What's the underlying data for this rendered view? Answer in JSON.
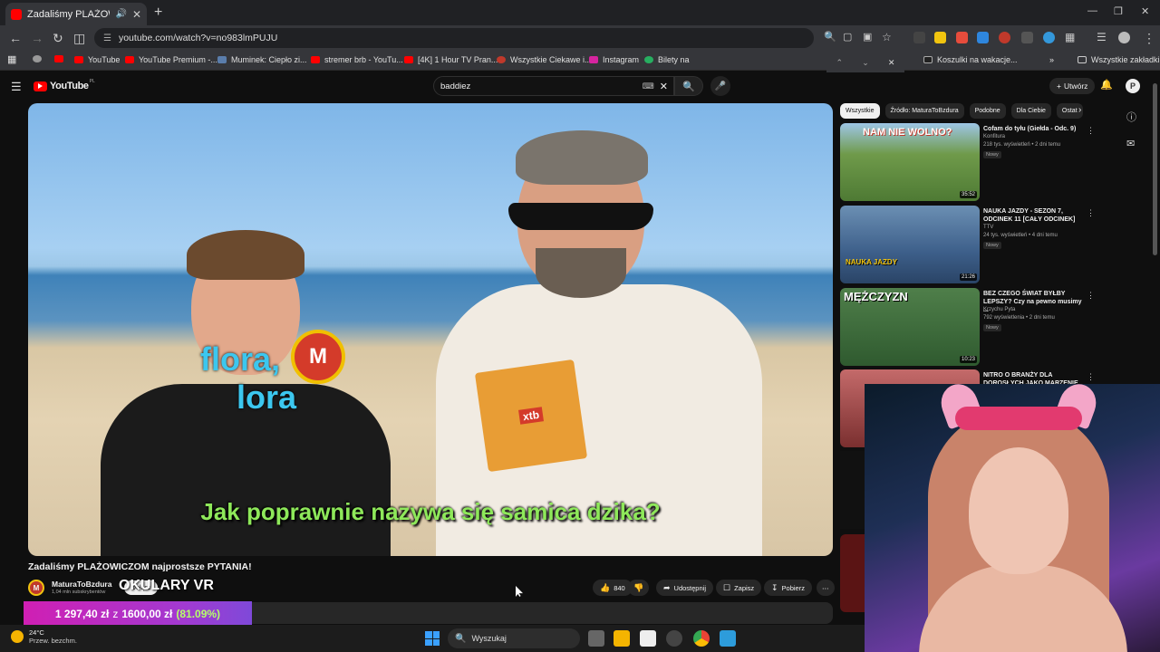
{
  "browser": {
    "tab_title": "Zadaliśmy PLAŻOWICZOM",
    "url": "youtube.com/watch?v=no983lmPUJU",
    "bookmarks": [
      "YouTube",
      "YouTube Premium -...",
      "Muminek: Ciepło zi...",
      "stremer brb - YouTu...",
      "[4K] 1 Hour TV Pran...",
      "Wszystkie Ciekawe i...",
      "Instagram",
      "Bilety na",
      "Koszulki na wakacje...",
      "Wszystkie zakładki"
    ]
  },
  "youtube": {
    "logo_text": "YouTube",
    "logo_region": "PL",
    "search_value": "baddiez",
    "create_label": "Utwórz",
    "account_initial": "P"
  },
  "video": {
    "overlay_words": [
      "flora,",
      "lora"
    ],
    "mic_letter": "M",
    "clipboard_brand": "xtb",
    "subtitle": "Jak poprawnie nazywa się samica dzika?",
    "title": "Zadaliśmy PLAŻOWICZOM najprostsze PYTANIA!",
    "channel_name": "MaturaToBzdura",
    "subscribers": "1,04 mln subskrybentów",
    "join_label": "Dołącz",
    "okulary_overlay": "OKULARY VR",
    "likes": "840",
    "share_label": "Udostępnij",
    "save_label": "Zapisz",
    "download_label": "Pobierz"
  },
  "donation": {
    "amount": "1 297,40 zł",
    "separator": "z",
    "goal": "1600,00 zł",
    "percent": "(81.09%)",
    "progress": 0.8109
  },
  "chips": [
    "Wszystkie",
    "Źródło: MaturaToBzdura",
    "Podobne",
    "Dla Ciebie",
    "Ostat"
  ],
  "recommendations": [
    {
      "title": "Cofam do tyłu (Giełda - Odc. 9)",
      "thumb_text": "NAM NIE WOLNO?",
      "channel": "Konfitura",
      "meta": "218 tys. wyświetleń • 2 dni temu",
      "badge": "Nowy",
      "duration": "35:52",
      "color": "#5b8a3c"
    },
    {
      "title": "NAUKA JAZDY - SEZON 7, ODCINEK 11 [CAŁY ODCINEK]",
      "thumb_text": "NAUKA JAZDY",
      "channel": "TTV",
      "meta": "24 tys. wyświetleń • 4 dni temu",
      "badge": "Nowy",
      "duration": "21:26",
      "color": "#3d5f8a"
    },
    {
      "title": "BEZ CZEGO ŚWIAT BYŁBY LEPSZY? Czy na pewno musimy ...",
      "thumb_text": "MĘŻCZYZN",
      "channel": "Krzychu Pyta",
      "meta": "792 wyświetlenia • 2 dni temu",
      "badge": "Nowy",
      "duration": "10:23",
      "color": "#3a6b3a"
    },
    {
      "title": "NITRO O BRANŻY DLA DOROSŁYCH JAKO MARZENIE ...",
      "thumb_text": "",
      "channel": "",
      "meta": "",
      "badge": "",
      "duration": "",
      "color": "#8a3a3a"
    }
  ],
  "taskbar": {
    "temperature": "24°C",
    "weather": "Przew. bezchm.",
    "search_placeholder": "Wyszukaj"
  }
}
